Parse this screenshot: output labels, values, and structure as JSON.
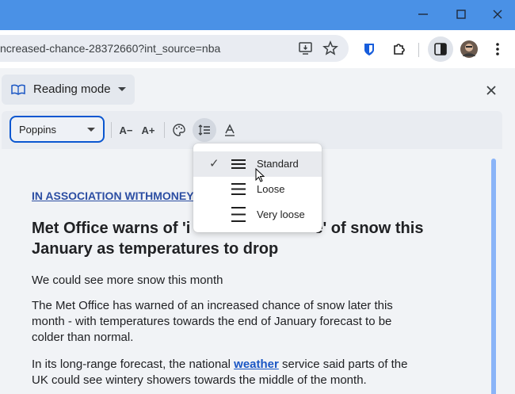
{
  "window": {
    "minimize_label": "—",
    "maximize_label": "☐",
    "close_label": "✕"
  },
  "toolbar": {
    "url": "ncreased-chance-28372660?int_source=nba"
  },
  "reading_mode": {
    "title": "Reading mode",
    "close_label": "✕",
    "font": "Poppins",
    "decrease_font_label": "A−",
    "increase_font_label": "A+",
    "line_spacing_menu": {
      "options": [
        {
          "label": "Standard",
          "selected": true
        },
        {
          "label": "Loose",
          "selected": false
        },
        {
          "label": "Very loose",
          "selected": false
        }
      ],
      "check_glyph": "✓"
    }
  },
  "article": {
    "association": "IN ASSOCIATION WITHMONEY",
    "headline_line1": "Met Office warns of 'i",
    "headline_line1_end": "e' of snow this",
    "headline_line2": "January as temperatures to drop",
    "subheading": "We could see more snow this month",
    "para1_line1": "The Met Office has warned of an increased chance of snow later this",
    "para1_line2": "month - with temperatures towards the end of January forecast to be",
    "para1_line3": "colder than normal.",
    "para2_before": "In its long-range forecast, the national ",
    "para2_link": "weather",
    "para2_after": " service said parts of the",
    "para2_line2": "UK could see wintery showers towards the middle of the month."
  },
  "colors": {
    "titlebar": "#4a91e6",
    "accent": "#0b57d0",
    "link": "#1a56c4"
  }
}
